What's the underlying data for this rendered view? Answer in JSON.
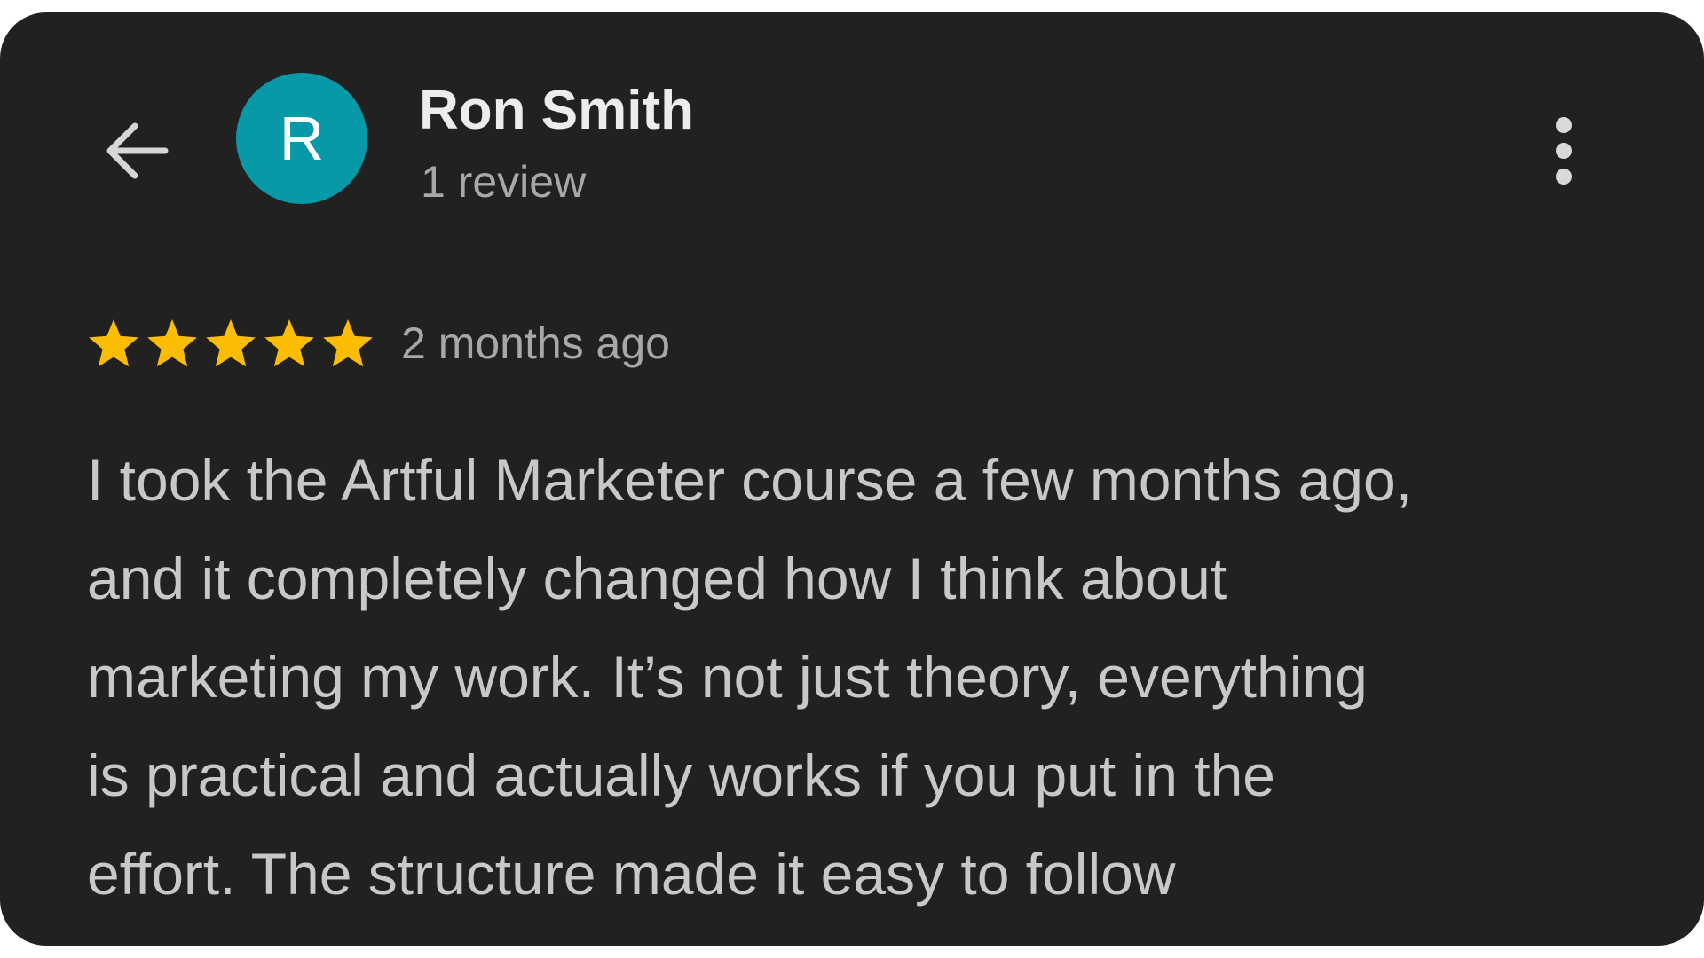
{
  "review": {
    "author": {
      "name": "Ron Smith",
      "initial": "R",
      "review_count": "1 review",
      "avatar_color": "#0899a8"
    },
    "rating": {
      "stars": 5,
      "max_stars": 5,
      "star_color": "#fbbc04"
    },
    "timestamp": "2 months ago",
    "text_lines": [
      "I took the Artful Marketer course a few months ago,",
      "and it completely changed how I think about",
      "marketing my work. It’s not just theory, everything",
      "is practical and actually works if you put in the",
      "effort. The structure made it easy to follow"
    ]
  },
  "icons": {
    "back": "arrow-back-icon",
    "more": "more-vert-icon",
    "star": "star-icon"
  },
  "colors": {
    "card_background": "#212121"
  }
}
